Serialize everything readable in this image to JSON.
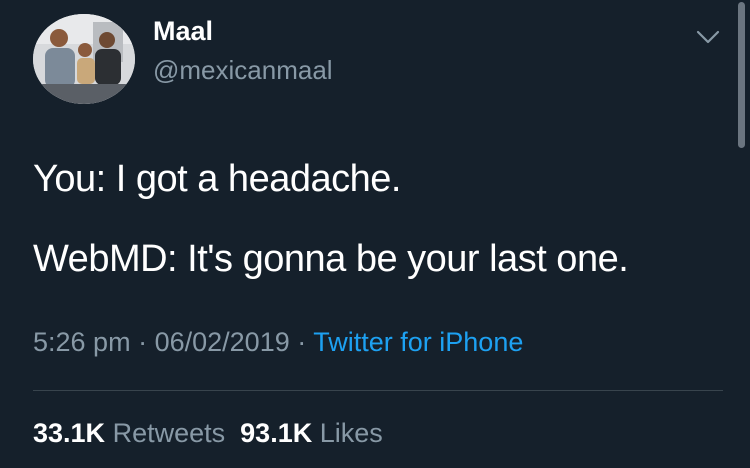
{
  "tweet": {
    "author": {
      "display_name": "Maal",
      "handle": "@mexicanmaal"
    },
    "menu_icon": "chevron-down-icon",
    "text_lines": [
      "You: I got a headache.",
      "WebMD: It's gonna be your last one."
    ],
    "time": "5:26 pm",
    "date": "06/02/2019",
    "separator": "·",
    "source": "Twitter for iPhone",
    "retweets": {
      "count": "33.1K",
      "label": "Retweets"
    },
    "likes": {
      "count": "93.1K",
      "label": "Likes"
    }
  },
  "colors": {
    "background": "#15202b",
    "primary_text": "#ffffff",
    "secondary_text": "#8899a6",
    "link": "#1da1f2",
    "divider": "#38444d"
  }
}
